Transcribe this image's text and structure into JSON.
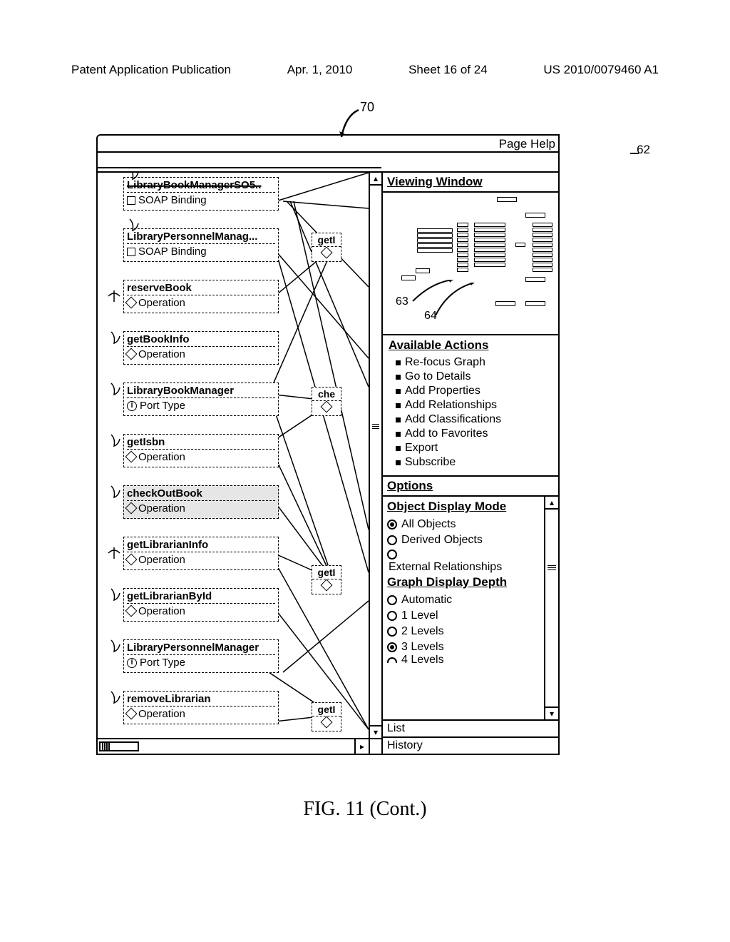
{
  "header": {
    "left": "Patent Application Publication",
    "date": "Apr. 1, 2010",
    "sheet": "Sheet 16 of 24",
    "pubno": "US 2010/0079460 A1"
  },
  "callouts": {
    "c70": "70",
    "c62": "62",
    "c63": "63",
    "c64": "64"
  },
  "titlebar": {
    "page_help": "Page Help"
  },
  "nodes": {
    "n0": {
      "title": "LibraryBookManagerSO5..",
      "sub": "SOAP Binding",
      "icon": "square"
    },
    "n1": {
      "title": "LibraryPersonnelManag...",
      "sub": "SOAP Binding",
      "icon": "square"
    },
    "n2": {
      "title": "reserveBook",
      "sub": "Operation",
      "icon": "diamond"
    },
    "n3": {
      "title": "getBookInfo",
      "sub": "Operation",
      "icon": "diamond"
    },
    "n4": {
      "title": "LibraryBookManager",
      "sub": "Port Type",
      "icon": "i"
    },
    "n5": {
      "title": "getIsbn",
      "sub": "Operation",
      "icon": "diamond"
    },
    "n6": {
      "title": "checkOutBook",
      "sub": "Operation",
      "icon": "diamond"
    },
    "n7": {
      "title": "getLibrarianInfo",
      "sub": "Operation",
      "icon": "diamond"
    },
    "n8": {
      "title": "getLibrarianById",
      "sub": "Operation",
      "icon": "diamond"
    },
    "n9": {
      "title": "LibraryPersonnelManager",
      "sub": "Port Type",
      "icon": "i"
    },
    "n10": {
      "title": "removeLibrarian",
      "sub": "Operation",
      "icon": "diamond"
    },
    "s1": {
      "title": "getI"
    },
    "s2": {
      "title": "che"
    },
    "s3": {
      "title": "getI"
    },
    "s4": {
      "title": "getI"
    }
  },
  "right": {
    "viewing_title": "Viewing Window",
    "actions_title": "Available Actions",
    "actions": [
      "Re-focus Graph",
      "Go to Details",
      "Add Properties",
      "Add Relationships",
      "Add Classifications",
      "Add to Favorites",
      "Export",
      "Subscribe"
    ],
    "options_title": "Options",
    "odm_title": "Object Display Mode",
    "odm": [
      {
        "label": "All Objects",
        "checked": true
      },
      {
        "label": "Derived Objects",
        "checked": false
      },
      {
        "label": "",
        "checked": false
      }
    ],
    "ext_rel": "External Relationships",
    "gdd_title": "Graph Display Depth",
    "gdd": [
      {
        "label": "Automatic",
        "checked": false
      },
      {
        "label": "1 Level",
        "checked": false
      },
      {
        "label": "2 Levels",
        "checked": false
      },
      {
        "label": "3 Levels",
        "checked": true
      },
      {
        "label": "4 Levels",
        "checked": false
      }
    ],
    "tab_list": "List",
    "tab_history": "History"
  },
  "caption": "FIG. 11 (Cont.)"
}
